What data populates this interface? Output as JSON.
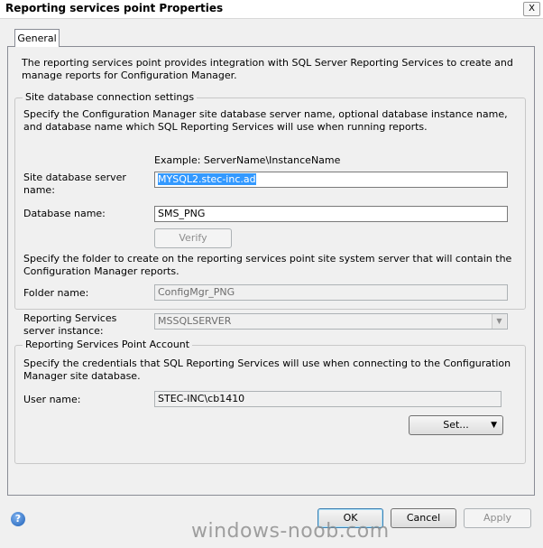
{
  "window": {
    "title": "Reporting services point Properties",
    "close_glyph": "X"
  },
  "tabs": [
    {
      "label": "General"
    }
  ],
  "intro": "The reporting services point provides integration with SQL Server Reporting Services to create and manage reports for Configuration Manager.",
  "site_db_group": {
    "legend": "Site database connection settings",
    "description": "Specify the Configuration Manager site database server name, optional database instance name, and database name which SQL Reporting Services will use when running reports.",
    "example": "Example: ServerName\\InstanceName",
    "server_label": "Site database server name:",
    "server_value": "MYSQL2.stec-inc.ad",
    "dbname_label": "Database name:",
    "dbname_value": "SMS_PNG",
    "verify_label": "Verify",
    "folder_desc": "Specify the folder to create on the reporting services point site system server that will contain the Configuration Manager reports.",
    "folder_label": "Folder name:",
    "folder_value": "ConfigMgr_PNG"
  },
  "instance": {
    "label": "Reporting Services server instance:",
    "value": "MSSQLSERVER"
  },
  "account_group": {
    "legend": "Reporting Services Point Account",
    "description": "Specify the credentials that SQL Reporting Services will use when connecting to the Configuration Manager site database.",
    "user_label": "User name:",
    "user_value": "STEC-INC\\cb1410",
    "set_label": "Set...",
    "set_arrow": "▼"
  },
  "footer": {
    "help_glyph": "?",
    "ok_label": "OK",
    "cancel_label": "Cancel",
    "apply_label": "Apply"
  },
  "watermark": "windows-noob.com"
}
